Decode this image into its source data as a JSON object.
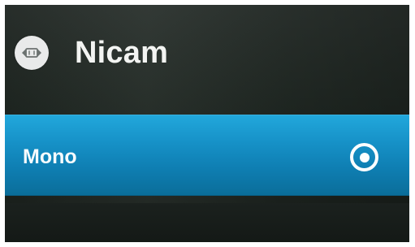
{
  "header": {
    "title": "Nicam",
    "icon": "nicam-audio-icon"
  },
  "options": [
    {
      "label": "Mono",
      "selected": true,
      "icon": "selected-radio-icon"
    }
  ],
  "colors": {
    "background": "#202823",
    "title_text": "#f3f4f2",
    "selected_row": "#1691c7",
    "radio": "#ffffff"
  }
}
